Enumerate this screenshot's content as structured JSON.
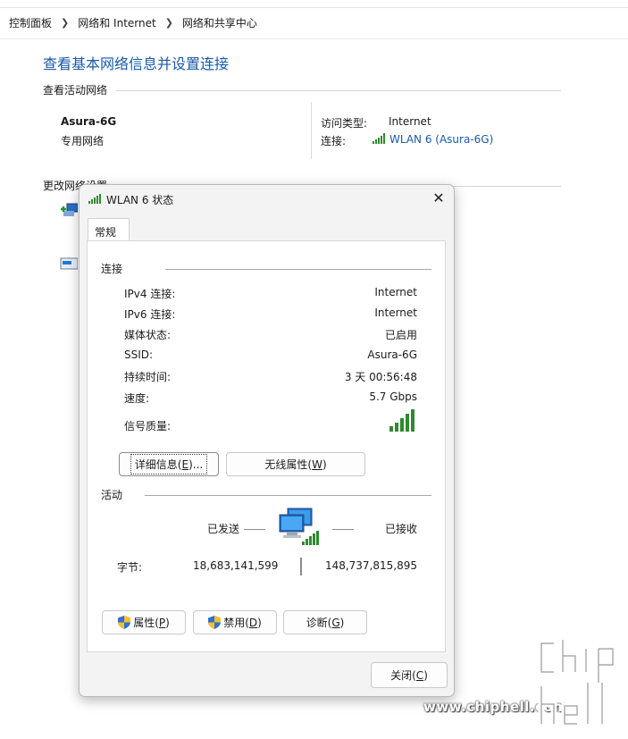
{
  "breadcrumb": [
    "控制面板",
    "网络和 Internet",
    "网络和共享中心"
  ],
  "page_title": "查看基本网络信息并设置连接",
  "active_networks": {
    "section_title": "查看活动网络",
    "name": "Asura-6G",
    "category": "专用网络",
    "access_type_label": "访问类型:",
    "access_type_value": "Internet",
    "connection_label": "连接:",
    "connection_value": "WLAN 6 (Asura-6G)"
  },
  "change_settings": {
    "section_title": "更改网络设置"
  },
  "dialog": {
    "title": "WLAN 6 状态",
    "tab": "常规",
    "connection_group": "连接",
    "rows": [
      {
        "label": "IPv4 连接:",
        "value": "Internet"
      },
      {
        "label": "IPv6 连接:",
        "value": "Internet"
      },
      {
        "label": "媒体状态:",
        "value": "已启用"
      },
      {
        "label": "SSID:",
        "value": "Asura-6G"
      },
      {
        "label": "持续时间:",
        "value": "3 天 00:56:48"
      },
      {
        "label": "速度:",
        "value": "5.7 Gbps"
      }
    ],
    "signal_label": "信号质量:",
    "details_button": {
      "text": "详细信息(",
      "key": "E",
      "suffix": ")..."
    },
    "wireless_button": {
      "text": "无线属性(",
      "key": "W",
      "suffix": ")"
    },
    "activity_group": "活动",
    "sent_label": "已发送",
    "received_label": "已接收",
    "bytes_label": "字节:",
    "bytes_sent": "18,683,141,599",
    "bytes_received": "148,737,815,895",
    "properties_button": {
      "text": "属性(",
      "key": "P",
      "suffix": ")"
    },
    "disable_button": {
      "text": "禁用(",
      "key": "D",
      "suffix": ")"
    },
    "diagnose_button": {
      "text": "诊断(",
      "key": "G",
      "suffix": ")"
    },
    "close_button": {
      "text": "关闭(",
      "key": "C",
      "suffix": ")"
    }
  },
  "watermark": {
    "text": "www.chiphell.com",
    "logo_text": "chip hell"
  },
  "colors": {
    "accent": "#1a5aa8",
    "signal": "#2e8b2e",
    "shield_blue": "#2f6fd6",
    "shield_yellow": "#f2c12e"
  }
}
